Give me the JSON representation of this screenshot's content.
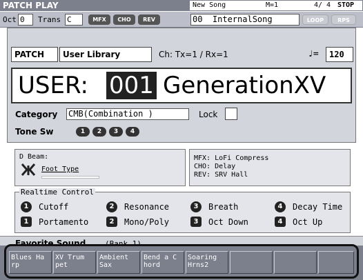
{
  "header": {
    "title": "PATCH PLAY",
    "song_name": "New Song",
    "measure": "M=1",
    "time_sig": "4/ 4",
    "transport": "STOP"
  },
  "status": {
    "oct_label": "Oct",
    "oct_value": "0",
    "trans_label": "Trans",
    "trans_value": "C",
    "fx_pills": [
      "MFX",
      "CHO",
      "REV"
    ],
    "song_number": "00",
    "song_title": "InternalSong",
    "loop_label": "LOOP",
    "rps_label": "RPS"
  },
  "patch": {
    "tag": "PATCH",
    "library": "User Library",
    "channel": "Ch: Tx=1  / Rx=1",
    "tempo_symbol": "♩=",
    "tempo": "120",
    "bank": "USER:",
    "number": "001",
    "name": "GenerationXV",
    "category_label": "Category",
    "category_value": "CMB(Combination )",
    "lock_label": "Lock",
    "tone_sw_label": "Tone Sw",
    "tones": [
      "1",
      "2",
      "3",
      "4"
    ]
  },
  "dbeam": {
    "label": "D Beam:",
    "type": "Foot Type"
  },
  "effects": {
    "mfx": "MFX: LoFi Compress",
    "cho": "CHO: Delay",
    "rev": "REV: SRV Hall"
  },
  "realtime": {
    "title": "Realtime Control",
    "knobs": [
      {
        "num": "1",
        "label": "Cutoff"
      },
      {
        "num": "2",
        "label": "Resonance"
      },
      {
        "num": "3",
        "label": "Breath"
      },
      {
        "num": "4",
        "label": "Decay Time"
      }
    ],
    "switches": [
      {
        "num": "1",
        "label": "Portamento"
      },
      {
        "num": "2",
        "label": "Mono/Poly"
      },
      {
        "num": "3",
        "label": "Oct Down"
      },
      {
        "num": "4",
        "label": "Oct Up"
      }
    ]
  },
  "favorite": {
    "label": "Favorite Sound",
    "bank": "(Bank 1)"
  },
  "favorites": [
    "Blues Ha\nrp",
    "XV Trum\npet",
    "Ambient\nSax",
    "Bend a C\nhord",
    "Soaring\nHrns2",
    "",
    "",
    ""
  ],
  "colors": {
    "frame": "#7c7f8c",
    "panel": "#d3d5dc",
    "subpanel": "#e4e5ea"
  }
}
